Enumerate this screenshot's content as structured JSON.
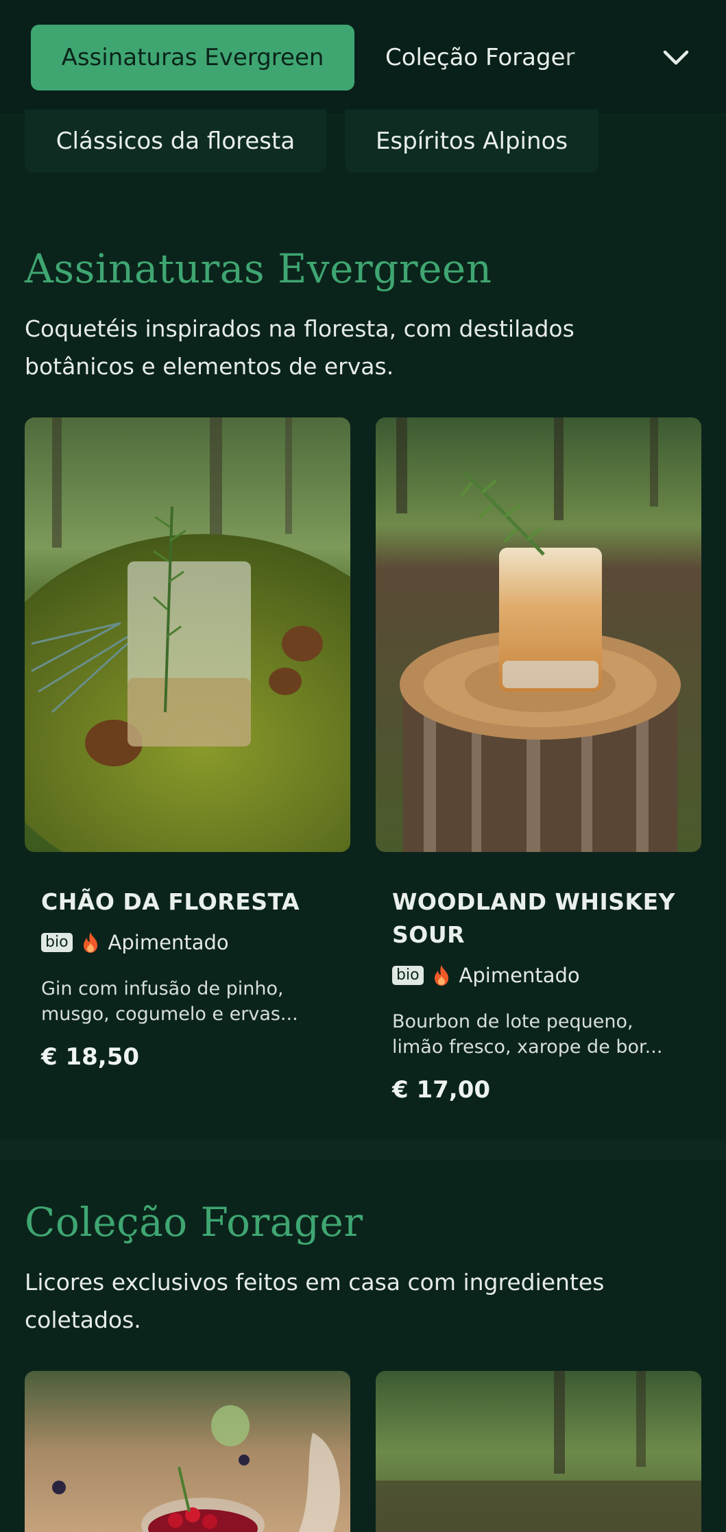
{
  "nav": {
    "tabs": [
      "Assinaturas Evergreen",
      "Coleção Forager"
    ],
    "active_tab": "Assinaturas Evergreen",
    "chips": [
      "Clássicos da floresta",
      "Espíritos Alpinos"
    ]
  },
  "sections": [
    {
      "title": "Assinaturas Evergreen",
      "description": "Coquetéis inspirados na floresta, com destilados botânicos e elementos de ervas.",
      "items": [
        {
          "name": "CHÃO DA FLORESTA",
          "badge": "bio",
          "tag": "Apimentado",
          "description": "Gin com infusão de pinho, musgo, cogumelo e ervas...",
          "price": "€ 18,50"
        },
        {
          "name": "WOODLAND WHISKEY SOUR",
          "badge": "bio",
          "tag": "Apimentado",
          "description": "Bourbon de lote pequeno, limão fresco, xarope de bor...",
          "price": "€ 17,00"
        }
      ]
    },
    {
      "title": "Coleção Forager",
      "description": "Licores exclusivos feitos em casa com ingredientes coletados."
    }
  ],
  "colors": {
    "background": "#0b241b",
    "accent": "#3fa672",
    "spicy_icon": "#f05a28"
  },
  "icons": [
    "chevron-down-icon",
    "fire-icon"
  ]
}
